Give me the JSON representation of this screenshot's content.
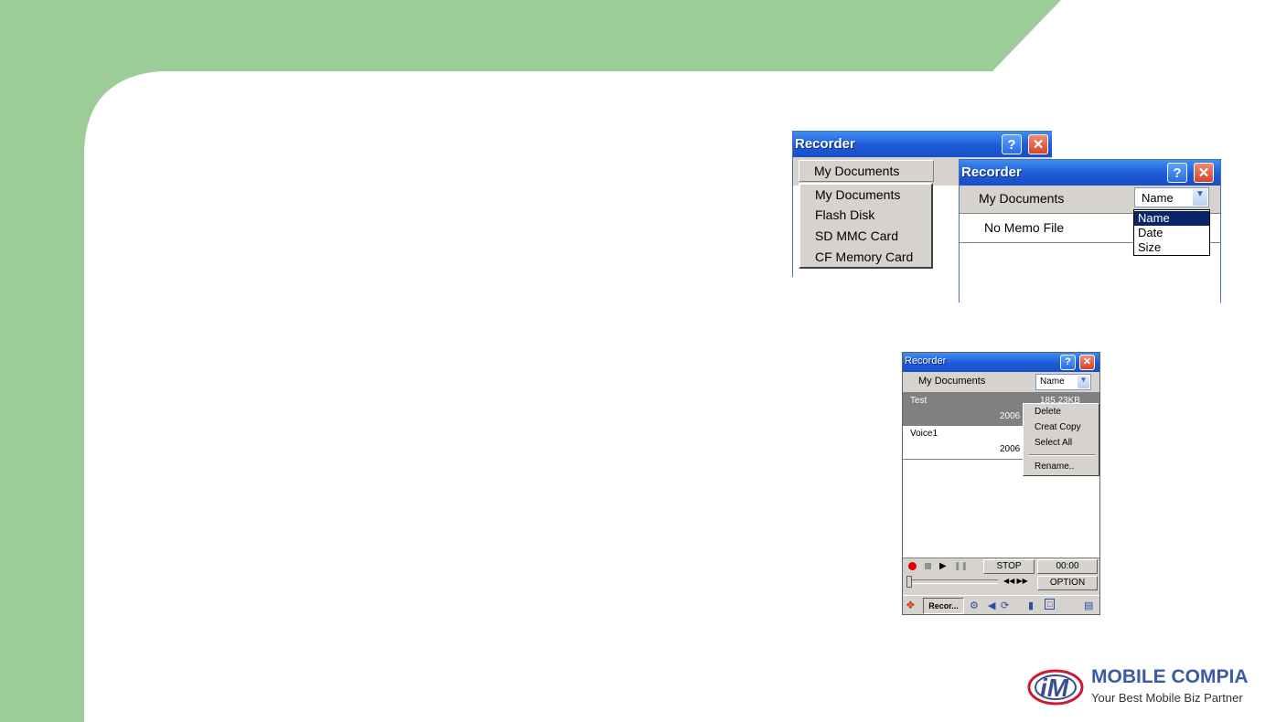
{
  "colors": {
    "slide_green": "#9ccc97",
    "titlebar_blue": "#1c5ad8",
    "selection_blue": "#0a246a",
    "selected_row_grey": "#808080",
    "record_red": "#e00000"
  },
  "window_a": {
    "title": "Recorder",
    "help_label": "?",
    "close_label": "✕",
    "folder_button": "My Documents",
    "folder_options": [
      "My Documents",
      "Flash Disk",
      "SD MMC Card",
      "CF Memory Card"
    ]
  },
  "window_b": {
    "title": "Recorder",
    "help_label": "?",
    "close_label": "✕",
    "folder_label": "My Documents",
    "sort_selected": "Name",
    "sort_options": [
      "Name",
      "Date",
      "Size"
    ],
    "empty_message": "No Memo File"
  },
  "window_c": {
    "title": "Recorder",
    "help_label": "?",
    "close_label": "✕",
    "folder_label": "My Documents",
    "sort_selected": "Name",
    "files": [
      {
        "name": "Test",
        "size": "185.23KB",
        "date": "2006"
      },
      {
        "name": "Voice1",
        "date": "2006"
      }
    ],
    "context_menu": [
      "Delete",
      "Creat Copy",
      "Select All",
      "Rename.."
    ],
    "stop_label": "STOP",
    "time": "00:00",
    "rewind_ff": "◀◀ ▶▶",
    "option_label": "OPTION",
    "taskbar_app": "Recor..."
  },
  "logo": {
    "brand": "MOBILE COMPIA",
    "tagline": "Your Best Mobile Biz Partner",
    "mark": "M"
  }
}
